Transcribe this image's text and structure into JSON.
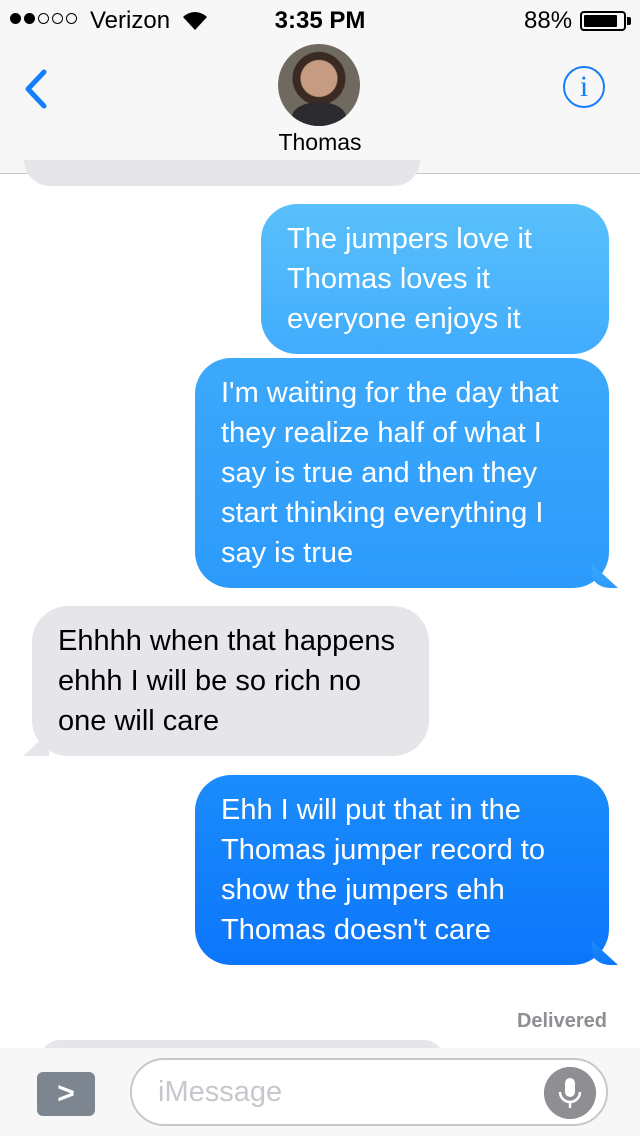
{
  "status_bar": {
    "carrier": "Verizon",
    "time": "3:35 PM",
    "battery_percent": "88%",
    "battery_level": 0.88,
    "signal_bars_filled": 2,
    "signal_bars_total": 5
  },
  "header": {
    "contact_name": "Thomas",
    "info_glyph": "i",
    "back_icon": "chevron-left-icon",
    "accent_color": "#157efb"
  },
  "messages": [
    {
      "direction": "outgoing",
      "text": "The jumpers love it Thomas loves it everyone enjoys it"
    },
    {
      "direction": "outgoing",
      "text": "I'm waiting for the day that they realize half of what I say is true and then they start thinking everything I say is true"
    },
    {
      "direction": "incoming",
      "text": "Ehhhh when that happens ehhh I will be so rich no one will care"
    },
    {
      "direction": "outgoing",
      "text": "Ehh I will put that in the Thomas jumper record to show the jumpers ehh Thomas doesn't care"
    }
  ],
  "delivery_status": "Delivered",
  "composer": {
    "placeholder": "iMessage",
    "expand_glyph": ">"
  },
  "colors": {
    "incoming_bubble": "#e5e5ea",
    "outgoing_bubble": "#157efb",
    "bar_background": "#f7f7f7"
  }
}
